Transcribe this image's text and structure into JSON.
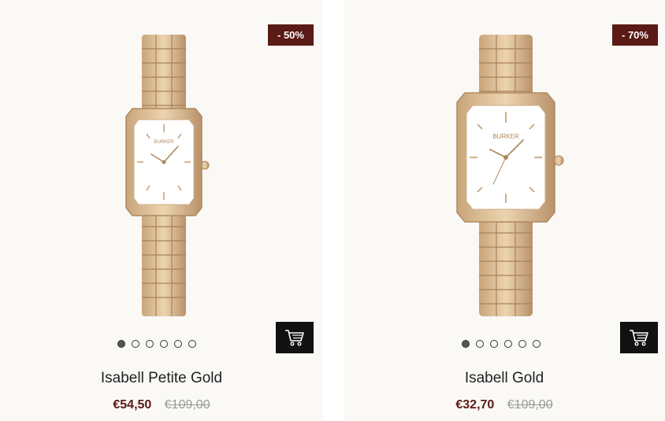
{
  "products": [
    {
      "badge": "- 50%",
      "name": "Isabell Petite Gold",
      "price": "€54,50",
      "old_price": "€109,00",
      "brand_mark": "BURKER",
      "carousel_dots": 6,
      "active_dot": 0,
      "cart_icon": "cart-icon"
    },
    {
      "badge": "- 70%",
      "name": "Isabell Gold",
      "price": "€32,70",
      "old_price": "€109,00",
      "brand_mark": "BURKER",
      "carousel_dots": 6,
      "active_dot": 0,
      "cart_icon": "cart-icon"
    }
  ],
  "colors": {
    "badge_bg": "#5a1a16",
    "price_accent": "#5a1a16",
    "gold": "#d4b48a",
    "cart_bg": "#111111"
  }
}
